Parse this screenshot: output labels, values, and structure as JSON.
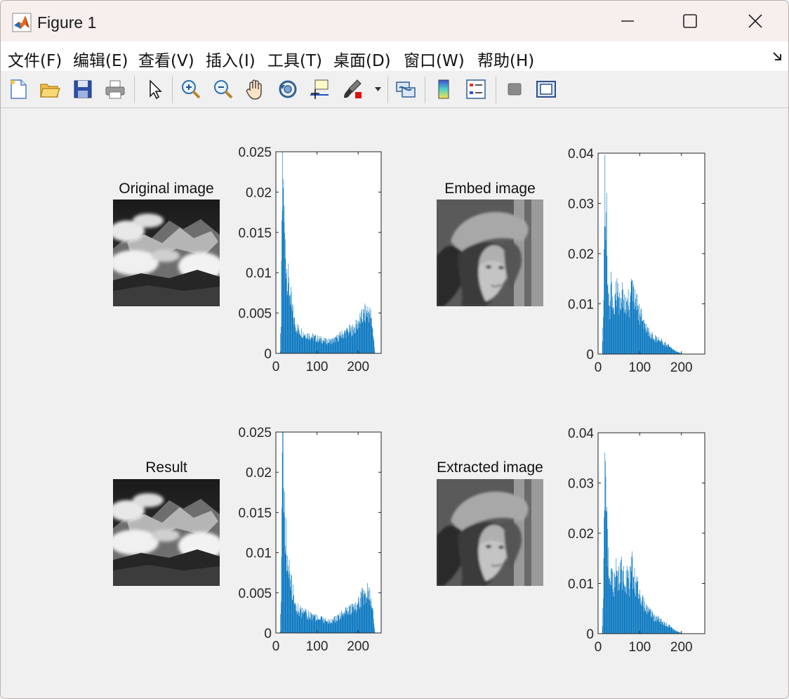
{
  "window": {
    "title": "Figure 1",
    "icon": "matlab-logo-icon",
    "controls": [
      "minimize-icon",
      "maximize-icon",
      "close-icon"
    ]
  },
  "menu": {
    "items": [
      "文件(F)",
      "编辑(E)",
      "查看(V)",
      "插入(I)",
      "工具(T)",
      "桌面(D)",
      "窗口(W)",
      "帮助(H)"
    ]
  },
  "toolbar": {
    "buttons": [
      "new-figure-icon",
      "open-file-icon",
      "save-icon",
      "print-icon",
      "edit-plot-arrow-icon",
      "zoom-in-icon",
      "zoom-out-icon",
      "pan-hand-icon",
      "rotate-3d-icon",
      "data-cursor-icon",
      "brush-icon",
      "link-plot-icon",
      "colorbar-icon",
      "legend-icon",
      "hide-plot-tools-icon",
      "show-plot-tools-icon"
    ]
  },
  "figure": {
    "images": [
      {
        "title": "Original image",
        "content": "grayscale mountain with clouds"
      },
      {
        "title": "Embed image",
        "content": "grayscale portrait with hat"
      },
      {
        "title": "Result",
        "content": "grayscale mountain with clouds"
      },
      {
        "title": "Extracted image",
        "content": "grayscale portrait with hat"
      }
    ]
  },
  "chart_data": [
    {
      "type": "bar",
      "xlim": [
        0,
        256
      ],
      "ylim": [
        0,
        0.025
      ],
      "xticks": [
        "0",
        "100",
        "200"
      ],
      "yticks": [
        "0",
        "0.005",
        "0.01",
        "0.015",
        "0.02",
        "0.025"
      ],
      "x": [
        10,
        12,
        14,
        16,
        18,
        20,
        22,
        25,
        28,
        32,
        36,
        40,
        45,
        50,
        55,
        60,
        70,
        80,
        90,
        100,
        110,
        120,
        130,
        140,
        150,
        160,
        170,
        180,
        190,
        200,
        210,
        215,
        220,
        225,
        230,
        235,
        238,
        240
      ],
      "values": [
        0.0002,
        0.004,
        0.014,
        0.0225,
        0.02,
        0.016,
        0.013,
        0.011,
        0.0095,
        0.008,
        0.0065,
        0.005,
        0.0038,
        0.0032,
        0.0029,
        0.0027,
        0.0024,
        0.0022,
        0.002,
        0.0018,
        0.0017,
        0.0015,
        0.0015,
        0.0016,
        0.0019,
        0.0023,
        0.0026,
        0.0028,
        0.003,
        0.0038,
        0.0045,
        0.0048,
        0.005,
        0.0052,
        0.0045,
        0.003,
        0.0015,
        0.0002
      ],
      "color": "#0072bd"
    },
    {
      "type": "bar",
      "xlim": [
        0,
        256
      ],
      "ylim": [
        0,
        0.04
      ],
      "xticks": [
        "0",
        "100",
        "200"
      ],
      "yticks": [
        "0",
        "0.01",
        "0.02",
        "0.03",
        "0.04"
      ],
      "x": [
        10,
        12,
        14,
        16,
        18,
        20,
        22,
        25,
        28,
        30,
        35,
        40,
        45,
        50,
        55,
        60,
        65,
        70,
        75,
        80,
        85,
        90,
        95,
        100,
        105,
        110,
        120,
        130,
        140,
        150,
        160,
        170,
        180,
        190,
        200
      ],
      "values": [
        0.002,
        0.008,
        0.021,
        0.036,
        0.026,
        0.031,
        0.018,
        0.012,
        0.008,
        0.014,
        0.009,
        0.011,
        0.013,
        0.01,
        0.0125,
        0.011,
        0.009,
        0.012,
        0.01,
        0.0135,
        0.011,
        0.0095,
        0.0095,
        0.0075,
        0.007,
        0.0055,
        0.0045,
        0.0035,
        0.003,
        0.0025,
        0.002,
        0.0015,
        0.0008,
        0.0004,
        0.0001
      ],
      "color": "#0072bd"
    },
    {
      "type": "bar",
      "xlim": [
        0,
        256
      ],
      "ylim": [
        0,
        0.025
      ],
      "xticks": [
        "0",
        "100",
        "200"
      ],
      "yticks": [
        "0",
        "0.005",
        "0.01",
        "0.015",
        "0.02",
        "0.025"
      ],
      "x": [
        10,
        12,
        14,
        16,
        18,
        20,
        22,
        25,
        28,
        32,
        36,
        40,
        45,
        50,
        55,
        60,
        70,
        80,
        90,
        100,
        110,
        120,
        130,
        140,
        150,
        160,
        170,
        180,
        190,
        200,
        210,
        215,
        220,
        225,
        230,
        235,
        238,
        240
      ],
      "values": [
        0.0002,
        0.004,
        0.014,
        0.0224,
        0.02,
        0.016,
        0.013,
        0.011,
        0.0095,
        0.008,
        0.0065,
        0.005,
        0.0038,
        0.0032,
        0.0029,
        0.0027,
        0.0024,
        0.0022,
        0.002,
        0.0018,
        0.0017,
        0.0015,
        0.0015,
        0.0016,
        0.0019,
        0.0023,
        0.0026,
        0.0028,
        0.003,
        0.0038,
        0.0045,
        0.0048,
        0.005,
        0.0053,
        0.0045,
        0.003,
        0.0015,
        0.0002
      ],
      "color": "#0072bd"
    },
    {
      "type": "bar",
      "xlim": [
        0,
        256
      ],
      "ylim": [
        0,
        0.04
      ],
      "xticks": [
        "0",
        "100",
        "200"
      ],
      "yticks": [
        "0",
        "0.01",
        "0.02",
        "0.03",
        "0.04"
      ],
      "x": [
        10,
        12,
        14,
        16,
        18,
        20,
        22,
        25,
        28,
        30,
        35,
        40,
        45,
        50,
        55,
        60,
        65,
        70,
        75,
        80,
        85,
        90,
        95,
        100,
        105,
        110,
        120,
        130,
        140,
        150,
        160,
        170,
        180,
        190,
        200
      ],
      "values": [
        0.002,
        0.008,
        0.021,
        0.036,
        0.026,
        0.031,
        0.018,
        0.012,
        0.008,
        0.014,
        0.009,
        0.011,
        0.013,
        0.01,
        0.0125,
        0.011,
        0.009,
        0.012,
        0.01,
        0.0135,
        0.011,
        0.0095,
        0.0095,
        0.0075,
        0.007,
        0.0055,
        0.0045,
        0.0035,
        0.003,
        0.0025,
        0.002,
        0.0015,
        0.0008,
        0.0004,
        0.0001
      ],
      "color": "#0072bd"
    }
  ]
}
